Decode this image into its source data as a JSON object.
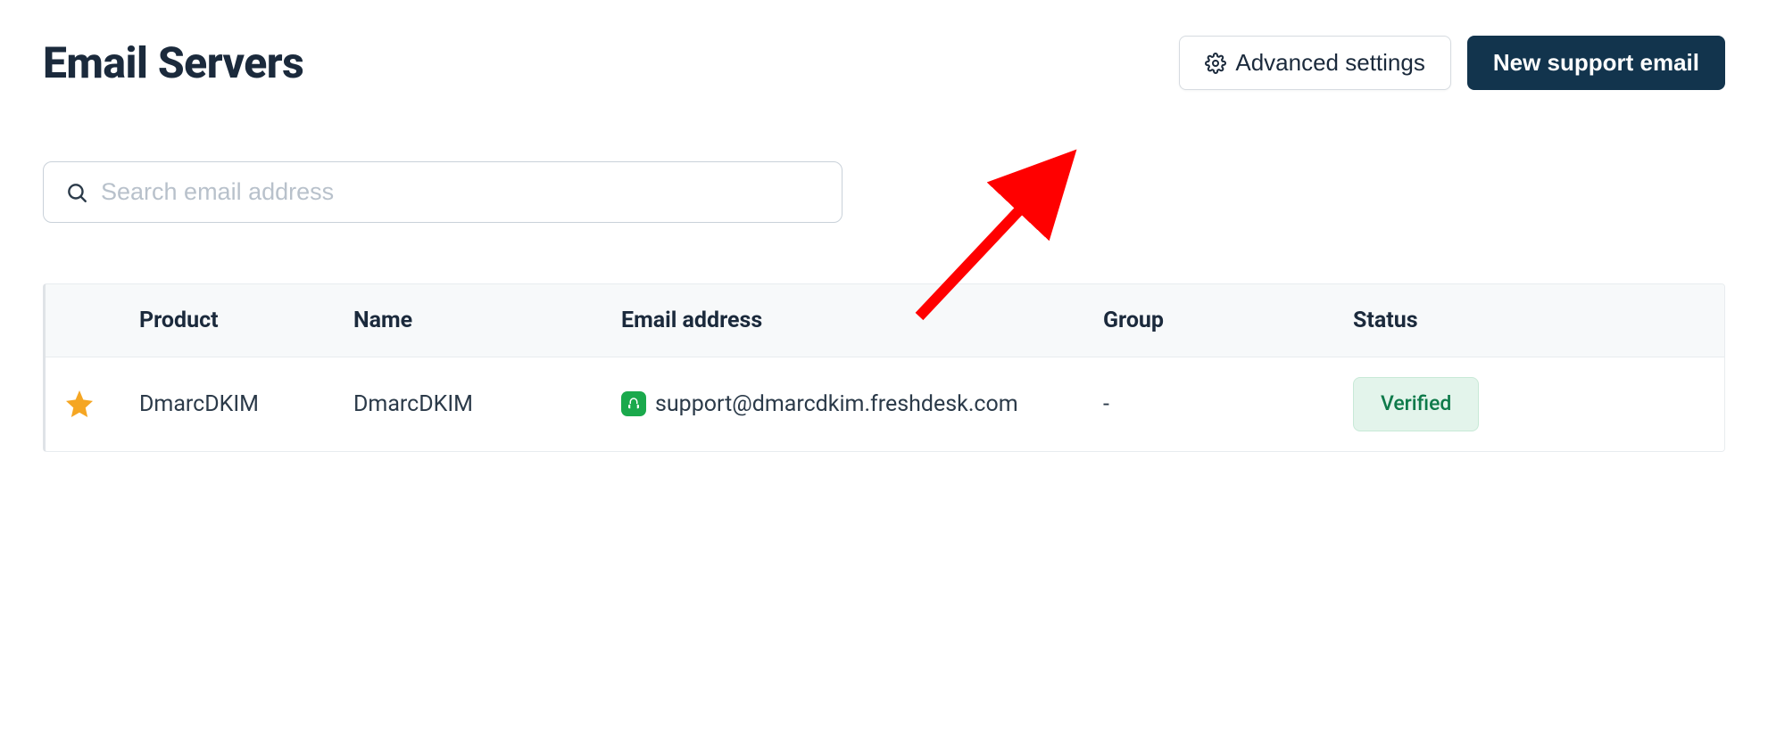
{
  "header": {
    "title": "Email Servers",
    "advanced_settings_label": "Advanced settings",
    "new_support_email_label": "New support email"
  },
  "search": {
    "placeholder": "Search email address"
  },
  "table": {
    "columns": {
      "product": "Product",
      "name": "Name",
      "email": "Email address",
      "group": "Group",
      "status": "Status"
    },
    "rows": [
      {
        "starred": true,
        "product": "DmarcDKIM",
        "name": "DmarcDKIM",
        "email": "support@dmarcdkim.freshdesk.com",
        "group": "-",
        "status": "Verified"
      }
    ]
  },
  "colors": {
    "primary_button": "#12344d",
    "text": "#1b2a3c",
    "star": "#f5a623",
    "verified_bg": "#e3f4eb",
    "verified_text": "#0e7a4a",
    "arrow": "#ff0000",
    "fresh_brand": "#1aa94c"
  }
}
